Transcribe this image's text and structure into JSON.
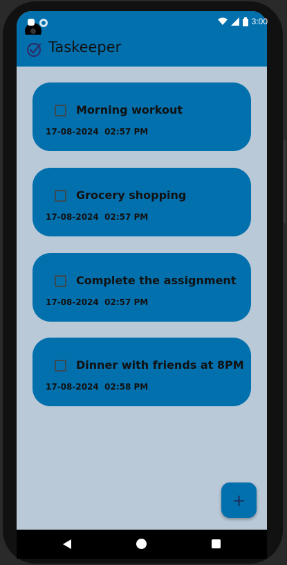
{
  "status_bar": {
    "time": "3:00",
    "icons": [
      "sim-icon",
      "sync-icon",
      "wifi-icon",
      "signal-icon",
      "battery-icon"
    ]
  },
  "app_bar": {
    "title": "Taskeeper",
    "icon": "check-circle-icon"
  },
  "tasks": [
    {
      "title": "Morning workout",
      "date": "17-08-2024",
      "time": "02:57 PM",
      "checked": false
    },
    {
      "title": "Grocery shopping",
      "date": "17-08-2024",
      "time": "02:57 PM",
      "checked": false
    },
    {
      "title": "Complete the assignment",
      "date": "17-08-2024",
      "time": "02:57 PM",
      "checked": false
    },
    {
      "title": "Dinner with friends at 8PM",
      "date": "17-08-2024",
      "time": "02:58 PM",
      "checked": false
    }
  ],
  "fab": {
    "symbol": "+"
  },
  "nav": {
    "icons": [
      "back-icon",
      "home-icon",
      "recents-icon"
    ]
  },
  "colors": {
    "primary": "#0270ad",
    "background": "#bac9d8",
    "text": "#111111"
  }
}
